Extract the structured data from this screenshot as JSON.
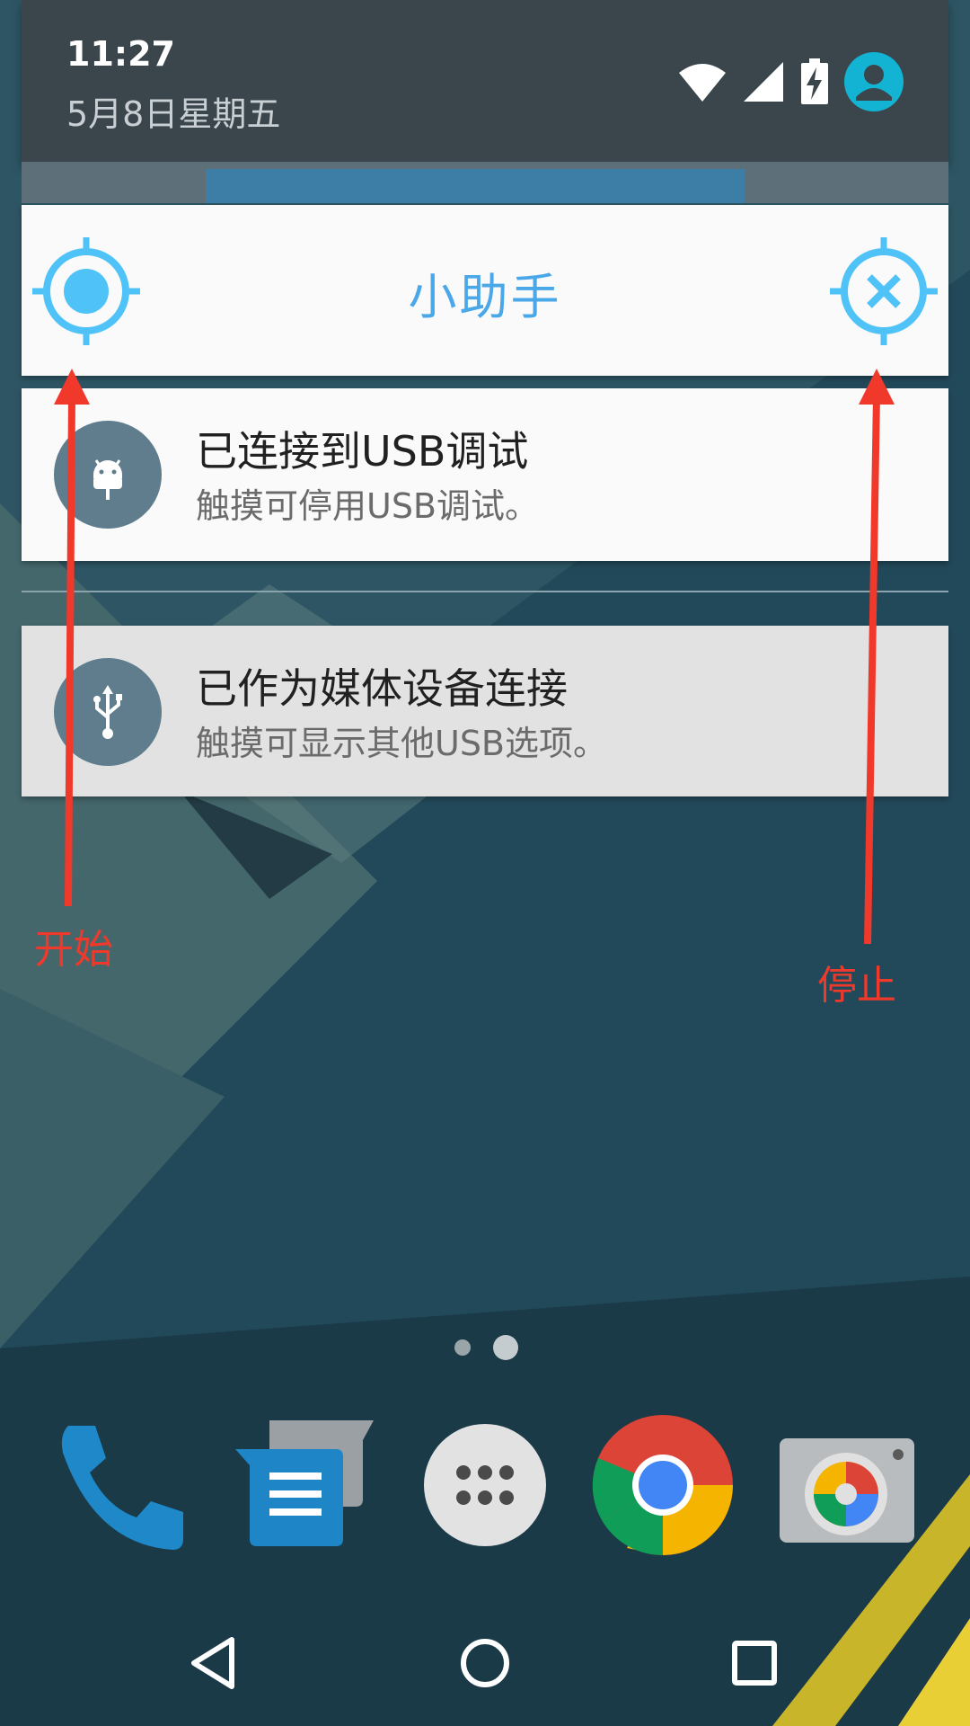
{
  "status": {
    "time": "11:27",
    "date": "5月8日星期五",
    "icons": [
      "wifi-icon",
      "signal-icon",
      "battery-charging-icon",
      "user-account-icon"
    ]
  },
  "helper": {
    "title": "小助手",
    "start_icon": "crosshair-target-icon",
    "stop_icon": "crosshair-close-icon",
    "accent_color": "#4aa8e8"
  },
  "notifications": [
    {
      "icon": "android-icon",
      "title": "已连接到USB调试",
      "text": "触摸可停用USB调试。"
    },
    {
      "icon": "usb-icon",
      "title": "已作为媒体设备连接",
      "text": "触摸可显示其他USB选项。"
    }
  ],
  "annotations": {
    "start_label": "开始",
    "stop_label": "停止",
    "color": "#f0392b"
  },
  "home": {
    "page_indicator": {
      "pages": 2
    },
    "dock": [
      "phone-icon",
      "messaging-icon",
      "app-drawer-icon",
      "chrome-icon",
      "camera-icon"
    ]
  },
  "navigation": [
    "back-icon",
    "home-icon",
    "recents-icon"
  ]
}
